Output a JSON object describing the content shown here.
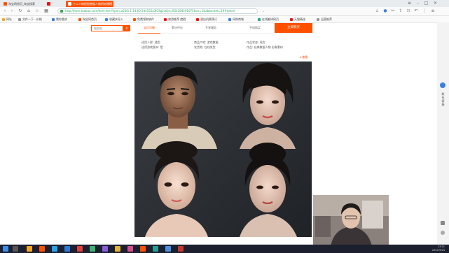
{
  "browser": {
    "tabs": [
      {
        "label": "淘宝网首页_淘宝搜索",
        "active": false
      },
      {
        "label": "",
        "active": false
      },
      {
        "label": "十二人物捏脸数据人物初始建模",
        "active": true
      }
    ],
    "url": "http://item.taobao.com/item.htm?spm=a230r.1.14.60.2d4552a3lC8g2s&id=654284491075&ns=1&abbucket=19#detail",
    "bookmarks": [
      "网址",
      "文件一下 · 价格",
      "猜你喜欢",
      "淘宝网首页",
      "收藏夹导入",
      "免费领取软件",
      "旅游推荐 度假",
      "酒店机票预订",
      "网购商城",
      "在线翻译网页",
      "天猫精选",
      "运营推荐"
    ]
  },
  "search": {
    "placeholder": "搜索框"
  },
  "detail_nav": {
    "tabs": [
      "宝贝详情",
      "累计评论",
      "专享服务",
      "手机购买"
    ],
    "buy_label": "立即购买"
  },
  "specs": [
    [
      "适用人群: 通用",
      "商品产地: 游戏数据",
      "作品状态: 现货"
    ],
    [
      "适用游戏版本: 是",
      "发货地: 在线发货",
      "作品: 经典数据人物 形象素材"
    ]
  ],
  "corner_text": "查看",
  "sidebar": {
    "text": "联系客服"
  },
  "clock": {
    "time": "13:21",
    "date": "2021/9/24"
  },
  "colors": {
    "brand": "#ff5000",
    "image_bg": "#2a2d31"
  }
}
